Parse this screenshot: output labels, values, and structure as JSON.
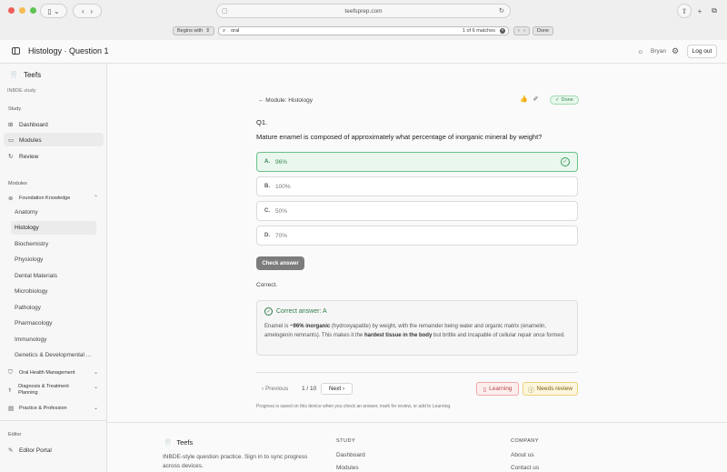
{
  "browser": {
    "url": "teefsprep.com",
    "find": {
      "mode": "Begins with",
      "query": "oral",
      "count": "1 of 6 matches",
      "done_label": "Done"
    }
  },
  "header": {
    "title": "Histology · Question 1",
    "user": "Bryan",
    "logout_label": "Log out"
  },
  "sidebar": {
    "brand": "Teefs",
    "subtitle": "INBDE study",
    "study_label": "Study",
    "study_items": [
      "Dashboard",
      "Modules",
      "Review"
    ],
    "modules_label": "Modules",
    "groups": [
      {
        "label": "Foundation Knowledge",
        "expanded": true,
        "items": [
          "Anatomy",
          "Histology",
          "Biochemistry",
          "Physiology",
          "Dental Materials",
          "Microbiology",
          "Pathology",
          "Pharmacology",
          "Immunology",
          "Genetics & Developmental ..."
        ]
      },
      {
        "label": "Oral Health Management"
      },
      {
        "label": "Diagnosis & Treatment Planning"
      },
      {
        "label": "Practice & Profession"
      }
    ],
    "editor_label": "Editor",
    "editor_item": "Editor Portal"
  },
  "main": {
    "back": "← Module: Histology",
    "done_badge": "Done",
    "qnum": "Q1.",
    "question": "Mature enamel is composed of approximately what percentage of inorganic mineral by weight?",
    "options": [
      {
        "letter": "A.",
        "text": "96%",
        "correct": true
      },
      {
        "letter": "B.",
        "text": "100%"
      },
      {
        "letter": "C.",
        "text": "50%"
      },
      {
        "letter": "D.",
        "text": "70%"
      }
    ],
    "check_label": "Check answer",
    "verdict": "Correct.",
    "explanation": {
      "heading": "Correct answer: A",
      "p1": "Enamel is ",
      "b1": "~96% inorganic",
      "p2": " (hydroxyapatite) by weight, with the remainder being water and organic matrix (enamelin, amelogenin remnants). This makes it the ",
      "b2": "hardest tissue in the body",
      "p3": " but brittle and incapable of cellular repair once formed."
    },
    "nav": {
      "prev": "‹ Previous",
      "page": "1 / 10",
      "next": "Next ›",
      "learning": "Learning",
      "needs_review": "Needs review"
    },
    "note": "Progress is saved on this device when you check an answer, mark for review, or add to Learning."
  },
  "footer": {
    "brand": "Teefs",
    "desc": "INBDE-style question practice. Sign in to sync progress across devices.",
    "study_head": "STUDY",
    "study_links": [
      "Dashboard",
      "Modules"
    ],
    "company_head": "COMPANY",
    "company_links": [
      "About us",
      "Contact us"
    ]
  },
  "colors": {
    "correct": "#3c9a5a",
    "learning": "#b54545",
    "review": "#7a5d10"
  }
}
